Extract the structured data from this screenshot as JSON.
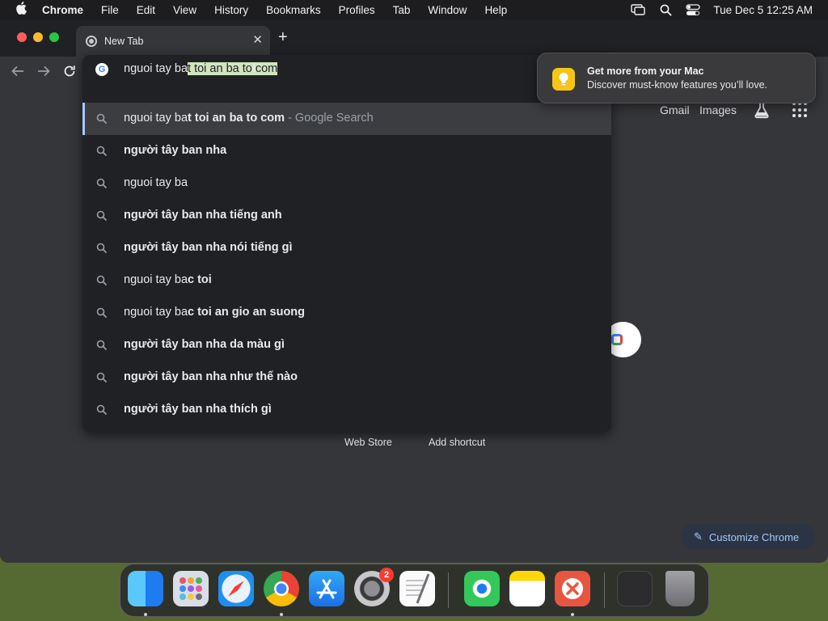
{
  "menubar": {
    "app_name": "Chrome",
    "items": [
      "File",
      "Edit",
      "View",
      "History",
      "Bookmarks",
      "Profiles",
      "Tab",
      "Window",
      "Help"
    ],
    "clock": "Tue Dec 5  12:25 AM"
  },
  "tab": {
    "title": "New Tab"
  },
  "omnibox": {
    "typed_prefix": "nguoi tay ba",
    "typed_selected": "t toi an ba to com",
    "suggestions": [
      {
        "normal": "nguoi tay ba",
        "bold": "t toi an ba to com",
        "suffix": " - Google Search"
      },
      {
        "normal": "",
        "bold": "người tây ban nha",
        "suffix": ""
      },
      {
        "normal": "nguoi tay ba",
        "bold": "",
        "suffix": ""
      },
      {
        "normal": "",
        "bold": "người tây ban nha tiếng anh",
        "suffix": ""
      },
      {
        "normal": "",
        "bold": "người tây ban nha nói tiếng gì",
        "suffix": ""
      },
      {
        "normal": "nguoi tay ba",
        "bold": "c toi",
        "suffix": ""
      },
      {
        "normal": "nguoi tay ba",
        "bold": "c toi an gio an suong",
        "suffix": ""
      },
      {
        "normal": "",
        "bold": "người tây ban nha da màu gì",
        "suffix": ""
      },
      {
        "normal": "",
        "bold": "người tây ban nha như thế nào",
        "suffix": ""
      },
      {
        "normal": "",
        "bold": "người tây ban nha thích gì",
        "suffix": ""
      }
    ]
  },
  "ntp": {
    "gmail": "Gmail",
    "images": "Images",
    "shortcut_1": "Web Store",
    "shortcut_2": "Add shortcut",
    "customize": "Customize Chrome"
  },
  "notification": {
    "title": "Get more from your Mac",
    "body": "Discover must-know features you’ll love."
  },
  "dock": {
    "apps": [
      "finder",
      "launchpad",
      "safari",
      "chrome",
      "app-store",
      "system-settings",
      "textedit",
      "find-my",
      "notes",
      "remote-desktop",
      "screenshot-preview",
      "trash"
    ],
    "settings_badge": "2"
  },
  "colors": {
    "omnibox_selection": "#cfe6bf",
    "accent_blue": "#a8c7fa"
  }
}
